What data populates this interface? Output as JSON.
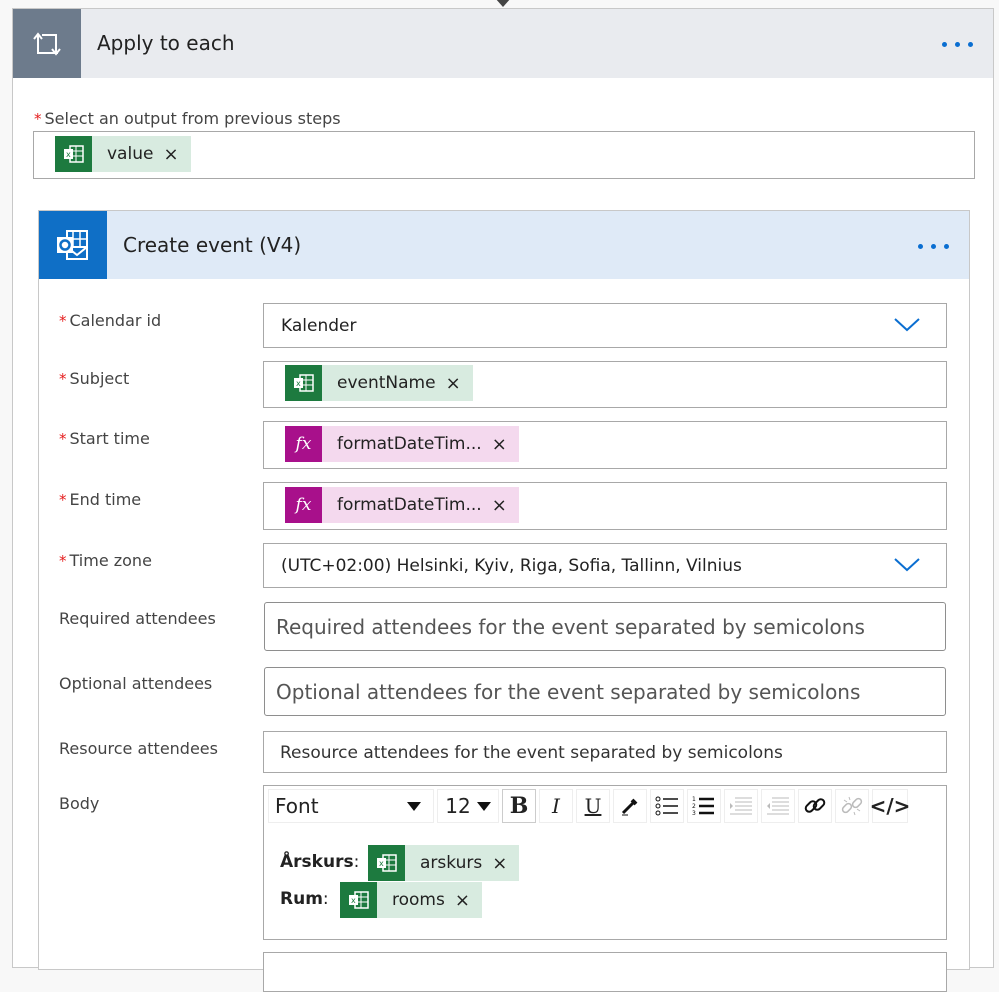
{
  "apply_to_each": {
    "title": "Apply to each",
    "icon": "loop-icon",
    "more_icon": "ellipsis-icon",
    "select_output": {
      "label": "Select an output from previous steps",
      "required_marker": "*",
      "token": {
        "source": "excel",
        "label": "value",
        "remove": "×"
      }
    }
  },
  "create_event": {
    "title": "Create event (V4)",
    "icon": "outlook-icon",
    "more_icon": "ellipsis-icon",
    "fields": {
      "calendar_id": {
        "label": "Calendar id",
        "required": "*",
        "value": "Kalender"
      },
      "subject": {
        "label": "Subject",
        "required": "*",
        "token": {
          "source": "excel",
          "label": "eventName",
          "remove": "×"
        }
      },
      "start_time": {
        "label": "Start time",
        "required": "*",
        "token": {
          "source": "expression",
          "icon_text": "fx",
          "label": "formatDateTim...",
          "remove": "×"
        }
      },
      "end_time": {
        "label": "End time",
        "required": "*",
        "token": {
          "source": "expression",
          "icon_text": "fx",
          "label": "formatDateTim...",
          "remove": "×"
        }
      },
      "time_zone": {
        "label": "Time zone",
        "required": "*",
        "value": "(UTC+02:00) Helsinki, Kyiv, Riga, Sofia, Tallinn, Vilnius"
      },
      "required_attendees": {
        "label": "Required attendees",
        "placeholder": "Required attendees for the event separated by semicolons"
      },
      "optional_attendees": {
        "label": "Optional attendees",
        "placeholder": "Optional attendees for the event separated by semicolons"
      },
      "resource_attendees": {
        "label": "Resource attendees",
        "placeholder": "Resource attendees for the event separated by semicolons"
      },
      "body": {
        "label": "Body",
        "toolbar": {
          "font": "Font",
          "size": "12",
          "bold": "B",
          "italic": "I",
          "underline": "U",
          "code": "</>"
        },
        "lines": [
          {
            "label": "Årskurs",
            "colon": ":",
            "token": {
              "source": "excel",
              "label": "arskurs",
              "remove": "×"
            }
          },
          {
            "label": "Rum",
            "colon": ":",
            "token": {
              "source": "excel",
              "label": "rooms",
              "remove": "×"
            }
          }
        ]
      }
    }
  },
  "colors": {
    "accent": "#0a6ed1",
    "excel_green": "#1d7a3f",
    "expression_purple": "#a8108b",
    "required_red": "#e51d1d"
  }
}
